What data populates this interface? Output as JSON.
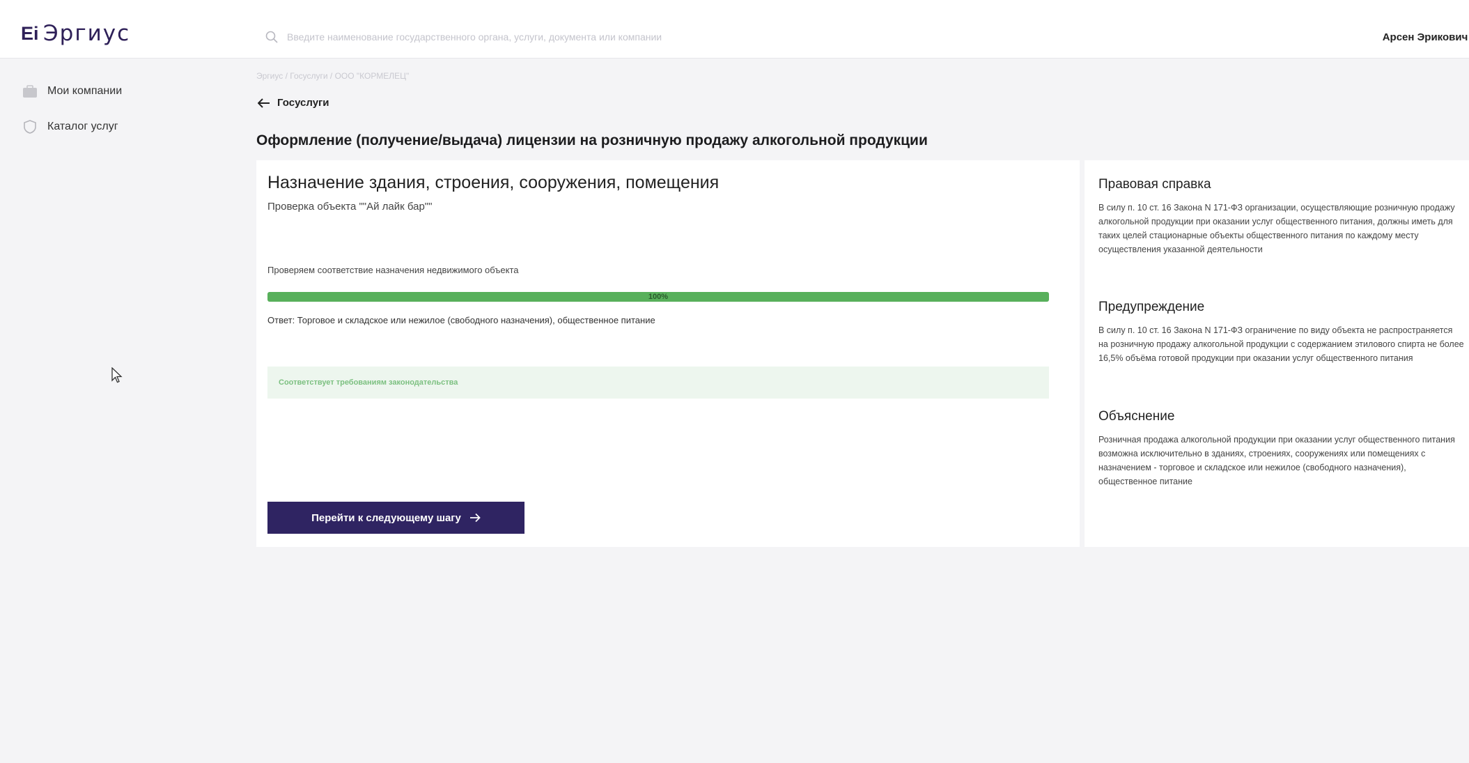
{
  "header": {
    "logo_mark": "Ei",
    "logo_text": "Эргиус",
    "search_placeholder": "Введите наименование государственного органа, услуги, документа или компании",
    "user_name": "Арсен Эрикович"
  },
  "sidebar": {
    "items": [
      {
        "label": "Мои компании",
        "icon": "briefcase-icon"
      },
      {
        "label": "Каталог услуг",
        "icon": "shield-icon"
      }
    ]
  },
  "breadcrumb": "Эргиус / Госуслуги / ООО \"КОРМЕЛЕЦ\"",
  "back_label": "Госуслуги",
  "page_title": "Оформление (получение/выдача) лицензии на розничную продажу алкогольной продукции",
  "step": {
    "title": "Назначение здания, строения, сооружения, помещения",
    "subtitle": "Проверка объекта \"\"Ай лайк бар\"\"",
    "check_label": "Проверяем соответствие назначения недвижимого объекта",
    "progress_value": 1.0,
    "progress_text": "100%",
    "answer": "Ответ: Торговое и складское или нежилое (свободного назначения), общественное питание",
    "status": "Соответствует требованиям законодательства",
    "next_button": "Перейти к следующему шагу"
  },
  "aside": {
    "sections": [
      {
        "title": "Правовая справка",
        "text": "В силу п. 10 ст. 16 Закона N 171-ФЗ организации, осуществляющие розничную продажу алкогольной продукции при оказании услуг общественного питания, должны иметь для таких целей стационарные объекты общественного питания по каждому месту осуществления указанной деятельности"
      },
      {
        "title": "Предупреждение",
        "text": "В силу п. 10 ст. 16 Закона N 171-ФЗ ограничение по виду объекта не распространяется на розничную продажу алкогольной продукции с содержанием этилового спирта не более 16,5% объёма готовой продукции при оказании услуг общественного питания"
      },
      {
        "title": "Объяснение",
        "text": "Розничная продажа алкогольной продукции при оказании услуг общественного питания возможна исключительно в зданиях, строениях, сооружениях или помещениях с назначением - торговое и складское или нежилое (свободного назначения), общественное питание"
      }
    ]
  },
  "colors": {
    "brand": "#2e2058",
    "button": "#2f2462",
    "progress": "#58b05b",
    "status_bg": "#edf6ee",
    "status_text": "#7cc080"
  }
}
